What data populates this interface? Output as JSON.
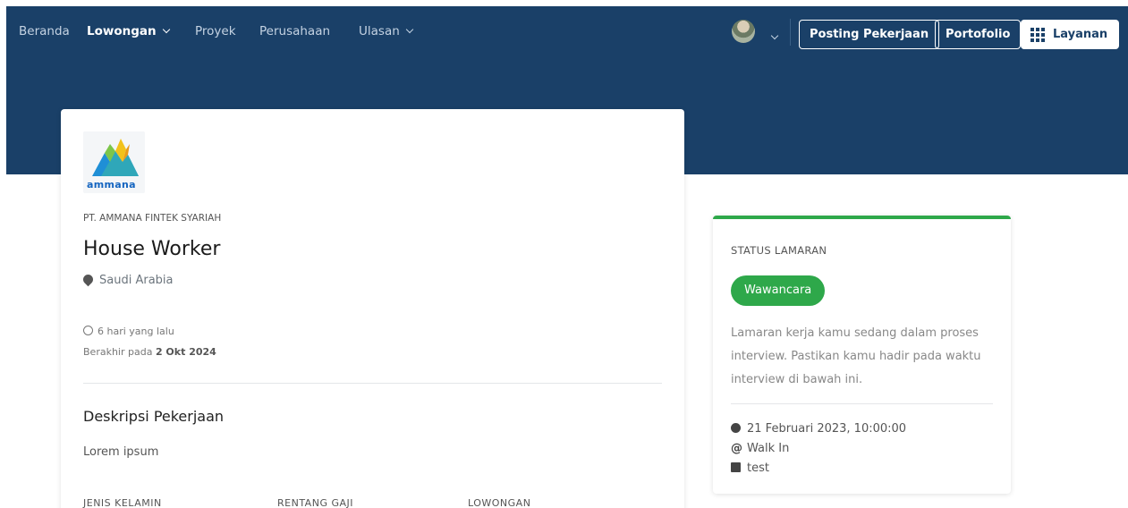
{
  "nav": {
    "items": [
      {
        "label": "Beranda",
        "active": false,
        "dropdown": false
      },
      {
        "label": "Lowongan",
        "active": true,
        "dropdown": true
      },
      {
        "label": "Proyek",
        "active": false,
        "dropdown": false
      },
      {
        "label": "Perusahaan",
        "active": false,
        "dropdown": false
      },
      {
        "label": "Ulasan",
        "active": false,
        "dropdown": true
      }
    ],
    "post_job_label": "Posting Pekerjaan",
    "portfolio_label": "Portofolio",
    "services_label": "Layanan"
  },
  "job": {
    "logo_text": "ammana",
    "company": "PT. AMMANA FINTEK SYARIAH",
    "title": "House Worker",
    "location": "Saudi Arabia",
    "posted": "6 hari yang lalu",
    "ends_prefix": "Berakhir pada",
    "ends_date": "2 Okt 2024",
    "description_title": "Deskripsi Pekerjaan",
    "description": "Lorem ipsum",
    "columns": [
      "JENIS KELAMIN",
      "RENTANG GAJI",
      "LOWONGAN"
    ]
  },
  "status": {
    "label": "STATUS LAMARAN",
    "badge": "Wawancara",
    "text": "Lamaran kerja kamu sedang dalam proses interview. Pastikan kamu hadir pada waktu interview di bawah ini.",
    "datetime": "21 Februari 2023, 10:00:00",
    "method": "Walk In",
    "note": "test"
  },
  "colors": {
    "navy": "#1a4068",
    "green": "#2ea84a"
  }
}
